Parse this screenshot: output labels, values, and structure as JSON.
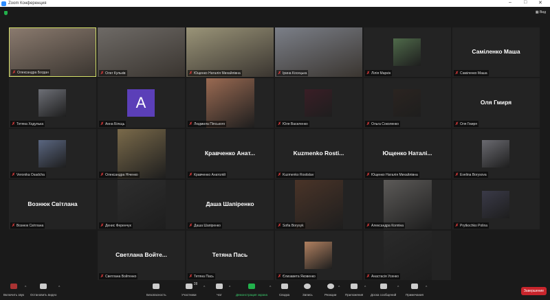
{
  "window": {
    "title": "Zoom Конференция",
    "minimize": "–",
    "maximize": "□",
    "close": "✕",
    "view_label": "Вид"
  },
  "tiles": [
    {
      "label": "Олександра Богдан",
      "type": "video",
      "color": "#8a7a6e",
      "active": true
    },
    {
      "label": "Олег Кульків",
      "type": "video",
      "color": "#6e6a66"
    },
    {
      "label": "Ющенко Наталія Михайлівна",
      "type": "video",
      "color": "#9a9478"
    },
    {
      "label": "Ірина Косецька",
      "type": "video",
      "color": "#7b7f88"
    },
    {
      "label": "Лілія Маркін",
      "type": "psmall",
      "color": "#4f6a4a"
    },
    {
      "label": "Саміленко Маша",
      "type": "name",
      "name": "Саміленко Маша"
    },
    {
      "label": "Тетяна Ходулька",
      "type": "psmall",
      "color": "#6d6f76"
    },
    {
      "label": "Анна Білєць",
      "type": "letter",
      "letter": "A"
    },
    {
      "label": "Людмила Піпського",
      "type": "ptall",
      "color": "#9a6a52"
    },
    {
      "label": "Юля Василенко",
      "type": "psmall",
      "color": "#3a1e26"
    },
    {
      "label": "Ольга Соколенко",
      "type": "psmall",
      "color": "#2b2420"
    },
    {
      "label": "Оля Гмиря",
      "type": "name",
      "name": "Оля Гмиря"
    },
    {
      "label": "Veronika Osadcha",
      "type": "psmall",
      "color": "#5a6680"
    },
    {
      "label": "Олександра Ніченко",
      "type": "ptall",
      "color": "#7a6a4a"
    },
    {
      "label": "Кравченко Анатолій",
      "type": "name",
      "name": "Кравченко  Анат..."
    },
    {
      "label": "Kuzmenko Rostislav",
      "type": "name",
      "name": "Kuzmenko  Rosti..."
    },
    {
      "label": "Ющенко Наталія Михайлівна",
      "type": "name",
      "name": "Ющенко  Наталі..."
    },
    {
      "label": "Evelina Borysova",
      "type": "psmall",
      "color": "#6a6a70"
    },
    {
      "label": "Вознюк Світлана",
      "type": "name",
      "name": "Вознюк Світлана"
    },
    {
      "label": "Денис Ференчук",
      "type": "ptall",
      "color": "#2e2e2e"
    },
    {
      "label": "Даша Шапіренко",
      "type": "name",
      "name": "Даша Шапіренко"
    },
    {
      "label": "Sofia Borysyk",
      "type": "ptall",
      "color": "#4a3428"
    },
    {
      "label": "Александра Колпіна",
      "type": "ptall",
      "color": "#5c5a58"
    },
    {
      "label": "Prytkochko Polina",
      "type": "psmall",
      "color": "#3a3a48"
    },
    {
      "label": "Светлана Войтенко",
      "type": "name",
      "name": "Светлана  Войте..."
    },
    {
      "label": "Тетяна Пась",
      "type": "name",
      "name": "Тетяна Пась"
    },
    {
      "label": "Єлизавета Яковенко",
      "type": "psmall",
      "color": "#b08060"
    },
    {
      "label": "Анастасія Усенко",
      "type": "ptall",
      "color": "#2a2a2a"
    }
  ],
  "toolbar": {
    "unmute": "Включить звук",
    "stop_video": "Остановить видео",
    "security": "Безопасность",
    "participants": "Участники",
    "participants_count": "28",
    "chat": "Чат",
    "share": "Демонстрация экрана",
    "summary": "Сводка",
    "record": "Запись",
    "reactions": "Реакции",
    "apps": "Приложения",
    "whiteboard": "Доска сообщений",
    "notes": "Примечания",
    "end": "Завершение"
  }
}
